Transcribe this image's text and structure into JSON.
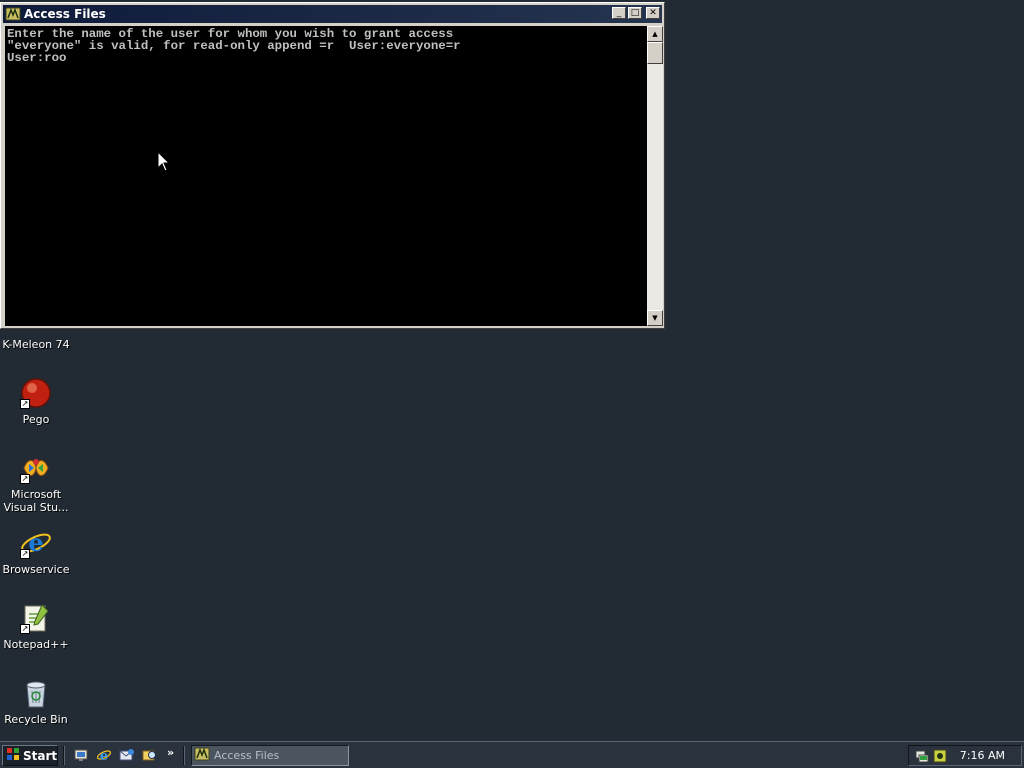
{
  "window": {
    "title": "Access Files",
    "minimize_glyph": "_",
    "maximize_glyph": "□",
    "close_glyph": "✕",
    "console_lines": [
      "Enter the name of the user for whom you wish to grant access",
      "\"everyone\" is valid, for read-only append =r  User:everyone=r",
      "User:roo"
    ],
    "scroll_up_glyph": "▲",
    "scroll_down_glyph": "▼"
  },
  "desktop": {
    "icons": [
      {
        "label": "K-Meleon 74",
        "icon": "kmeleon-icon"
      },
      {
        "label": "Pego",
        "icon": "pego-icon"
      },
      {
        "label": "Microsoft Visual Stu...",
        "icon": "visual-studio-icon"
      },
      {
        "label": "Browservice",
        "icon": "internet-explorer-icon"
      },
      {
        "label": "Notepad++",
        "icon": "notepadpp-icon"
      },
      {
        "label": "Recycle Bin",
        "icon": "recycle-bin-icon"
      }
    ],
    "shortcut_glyph": "↗"
  },
  "taskbar": {
    "start_label": "Start",
    "quick_launch_chevron": "»",
    "quick_launch": [
      "show-desktop-icon",
      "internet-explorer-icon",
      "outlook-express-icon",
      "explorer-search-icon"
    ],
    "task": {
      "label": "Access Files",
      "icon": "console-icon"
    },
    "tray_icons": [
      "network-icon",
      "tray-app-icon"
    ],
    "clock": "7:16 AM"
  },
  "colors": {
    "desktop_bg": "#222a33",
    "console_bg": "#000000",
    "console_text": "#c0c0c0",
    "taskbar_bg": "#2a333d"
  }
}
